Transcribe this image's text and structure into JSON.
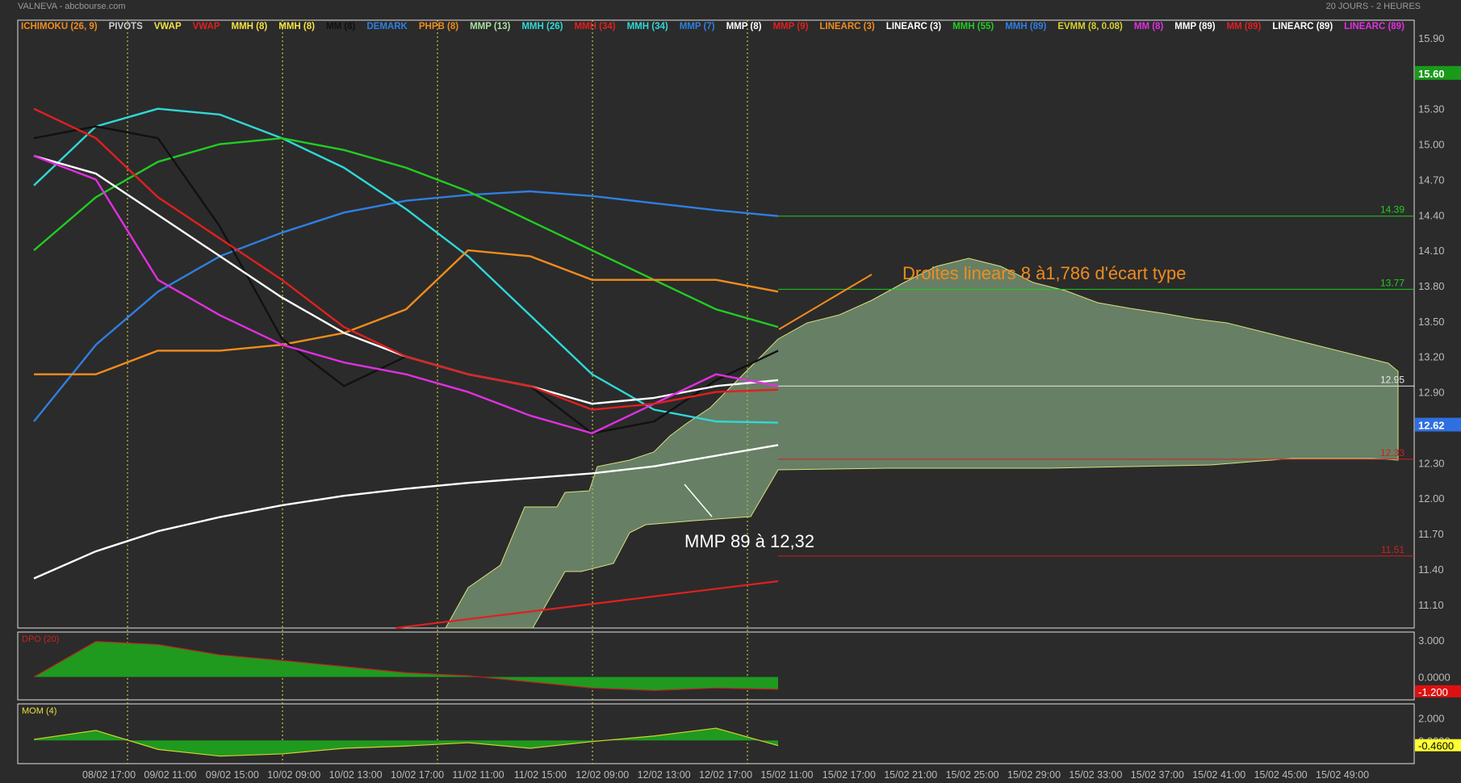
{
  "header": {
    "title": "VALNEVA - abcbourse.com",
    "period": "20 JOURS - 2 HEURES"
  },
  "legend": [
    {
      "label": "ICHIMOKU (26, 9)",
      "color": "#f08c1e"
    },
    {
      "label": "PIVOTS",
      "color": "#cfcfcf"
    },
    {
      "label": "VWAP",
      "color": "#f4e242"
    },
    {
      "label": "VWAP",
      "color": "#e02020"
    },
    {
      "label": "MMH (8)",
      "color": "#f4e242"
    },
    {
      "label": "MMH (8)",
      "color": "#f4e242"
    },
    {
      "label": "MM (8)",
      "color": "#111111"
    },
    {
      "label": "DEMARK",
      "color": "#2f7fe0"
    },
    {
      "label": "PHPB (8)",
      "color": "#f08c1e"
    },
    {
      "label": "MMP (13)",
      "color": "#a8e0a0"
    },
    {
      "label": "MMH (26)",
      "color": "#30d8d8"
    },
    {
      "label": "MMH (34)",
      "color": "#e02020"
    },
    {
      "label": "MMH (34)",
      "color": "#30d8d8"
    },
    {
      "label": "MMP (7)",
      "color": "#2f7fe0"
    },
    {
      "label": "MMP (8)",
      "color": "#ffffff"
    },
    {
      "label": "MMP (9)",
      "color": "#e02020"
    },
    {
      "label": "LINEARC (3)",
      "color": "#f08c1e"
    },
    {
      "label": "LINEARC (3)",
      "color": "#ffffff"
    },
    {
      "label": "MMH (55)",
      "color": "#22cc22"
    },
    {
      "label": "MMH (89)",
      "color": "#2f7fe0"
    },
    {
      "label": "EVMM (8, 0.08)",
      "color": "#d8d030"
    },
    {
      "label": "MM (8)",
      "color": "#e030e0"
    },
    {
      "label": "MMP (89)",
      "color": "#ffffff"
    },
    {
      "label": "MM (89)",
      "color": "#e02020"
    },
    {
      "label": "LINEARC (89)",
      "color": "#ffffff"
    },
    {
      "label": "LINEARC (89)",
      "color": "#e030e0"
    }
  ],
  "annotations": {
    "linear_note": "Droites linears 8 à1,786 d'écart type",
    "mmp_note": "MMP 89 à 12,32"
  },
  "chart_data": [
    {
      "type": "line",
      "title": "",
      "y_ticks": [
        "15.90",
        "15.60",
        "15.30",
        "15.00",
        "14.70",
        "14.40",
        "14.10",
        "13.80",
        "13.50",
        "13.20",
        "12.90",
        "12.60",
        "12.30",
        "12.00",
        "11.70",
        "11.40",
        "11.10"
      ],
      "ylim": [
        10.9,
        16.05
      ],
      "x_ticks": [
        "08/02 17:00",
        "09/02 11:00",
        "09/02 15:00",
        "10/02 09:00",
        "10/02 13:00",
        "10/02 17:00",
        "11/02 11:00",
        "11/02 15:00",
        "12/02 09:00",
        "12/02 13:00",
        "12/02 17:00",
        "15/02 11:00",
        "15/02 17:00",
        "15/02 21:00",
        "15/02 25:00",
        "15/02 29:00",
        "15/02 33:00",
        "15/02 37:00",
        "15/02 41:00",
        "15/02 45:00",
        "15/02 49:00"
      ],
      "markers": [
        {
          "label": "15.60",
          "value": 15.6,
          "color": "#1a9a1a"
        },
        {
          "label": "12.62",
          "value": 12.62,
          "color": "#2f6fe0"
        }
      ],
      "levels": [
        {
          "label": "14.39",
          "value": 14.39,
          "color": "#22cc22"
        },
        {
          "label": "13.77",
          "value": 13.77,
          "color": "#22cc22"
        },
        {
          "label": "12.95",
          "value": 12.95,
          "color": "#e8e8e8"
        },
        {
          "label": "12.33",
          "value": 12.33,
          "color": "#d02020"
        },
        {
          "label": "11.51",
          "value": 11.51,
          "color": "#d02020"
        }
      ],
      "series": [
        {
          "name": "MMP (89)",
          "color": "#ffffff",
          "x": [
            0,
            2,
            4,
            6,
            8,
            10,
            12,
            14,
            16,
            18,
            20,
            22,
            24
          ],
          "values": [
            11.32,
            11.55,
            11.72,
            11.84,
            11.94,
            12.02,
            12.08,
            12.13,
            12.17,
            12.21,
            12.27,
            12.36,
            12.45
          ]
        },
        {
          "name": "MMH (89)",
          "color": "#2f7fe0",
          "x": [
            0,
            2,
            4,
            6,
            8,
            10,
            12,
            14,
            16,
            18,
            20,
            22,
            24
          ],
          "values": [
            12.65,
            13.3,
            13.75,
            14.05,
            14.25,
            14.42,
            14.52,
            14.57,
            14.6,
            14.56,
            14.5,
            14.44,
            14.39
          ]
        },
        {
          "name": "MMH (26)",
          "color": "#30d8d8",
          "x": [
            0,
            2,
            4,
            6,
            8,
            10,
            12,
            14,
            16,
            18,
            20,
            22,
            24
          ],
          "values": [
            14.65,
            15.15,
            15.3,
            15.25,
            15.05,
            14.8,
            14.45,
            14.05,
            13.55,
            13.05,
            12.75,
            12.65,
            12.64
          ]
        },
        {
          "name": "MMH (55)",
          "color": "#22cc22",
          "x": [
            0,
            2,
            4,
            6,
            8,
            10,
            12,
            14,
            16,
            18,
            20,
            22,
            24
          ],
          "values": [
            14.1,
            14.55,
            14.85,
            15.0,
            15.05,
            14.95,
            14.8,
            14.6,
            14.35,
            14.1,
            13.85,
            13.6,
            13.45
          ]
        },
        {
          "name": "PHPB (8)",
          "color": "#f08c1e",
          "x": [
            0,
            2,
            4,
            6,
            8,
            10,
            12,
            14,
            16,
            18,
            20,
            22,
            24
          ],
          "values": [
            13.05,
            13.05,
            13.25,
            13.25,
            13.3,
            13.4,
            13.6,
            14.1,
            14.05,
            13.85,
            13.85,
            13.85,
            13.75
          ]
        },
        {
          "name": "MM (8)",
          "color": "#111111",
          "x": [
            0,
            2,
            4,
            6,
            8,
            10,
            12,
            14,
            16,
            18,
            20,
            22,
            24
          ],
          "values": [
            15.05,
            15.15,
            15.05,
            14.3,
            13.35,
            12.95,
            13.2,
            13.05,
            12.95,
            12.55,
            12.65,
            13.0,
            13.25
          ]
        },
        {
          "name": "MMP (8)",
          "color": "#ffffff",
          "x": [
            0,
            2,
            4,
            6,
            8,
            10,
            12,
            14,
            16,
            18,
            20,
            22,
            24
          ],
          "values": [
            14.9,
            14.75,
            14.4,
            14.05,
            13.7,
            13.4,
            13.2,
            13.05,
            12.95,
            12.8,
            12.85,
            12.95,
            13.0
          ]
        },
        {
          "name": "MM (8)",
          "color": "#e030e0",
          "x": [
            0,
            2,
            4,
            6,
            8,
            10,
            12,
            14,
            16,
            18,
            20,
            22,
            24
          ],
          "values": [
            14.9,
            14.7,
            13.85,
            13.55,
            13.3,
            13.15,
            13.05,
            12.9,
            12.7,
            12.55,
            12.8,
            13.05,
            12.95
          ]
        },
        {
          "name": "VWAP",
          "color": "#e02020",
          "x": [
            0,
            2,
            4,
            6,
            8,
            10,
            12,
            14,
            16,
            18,
            20,
            22,
            24
          ],
          "values": [
            15.3,
            15.05,
            14.55,
            14.2,
            13.85,
            13.45,
            13.2,
            13.05,
            12.95,
            12.75,
            12.8,
            12.9,
            12.92
          ]
        }
      ]
    },
    {
      "type": "area",
      "title": "DPO (20)",
      "y_ticks": [
        "3.000",
        "0.0000"
      ],
      "marker": {
        "label": "-1.200",
        "value": -1.2,
        "color": "#dd1111"
      },
      "ylim": [
        -1.8,
        3.6
      ],
      "x": [
        0,
        2,
        4,
        6,
        8,
        10,
        12,
        14,
        16,
        18,
        20,
        22,
        24
      ],
      "values": [
        0.0,
        2.9,
        2.65,
        1.8,
        1.35,
        0.85,
        0.35,
        0.1,
        -0.4,
        -0.9,
        -1.1,
        -0.9,
        -1.0
      ]
    },
    {
      "type": "area",
      "title": "MOM (4)",
      "y_ticks": [
        "2.000",
        "0.0000"
      ],
      "marker": {
        "label": "-0.4600",
        "value": -0.46,
        "color": "#ffff33"
      },
      "ylim": [
        -2.0,
        3.2
      ],
      "x": [
        0,
        2,
        4,
        6,
        8,
        10,
        12,
        14,
        16,
        18,
        20,
        22,
        24
      ],
      "values": [
        0.1,
        0.9,
        -0.8,
        -1.4,
        -1.2,
        -0.7,
        -0.5,
        -0.2,
        -0.7,
        -0.1,
        0.4,
        1.1,
        -0.46
      ]
    }
  ]
}
